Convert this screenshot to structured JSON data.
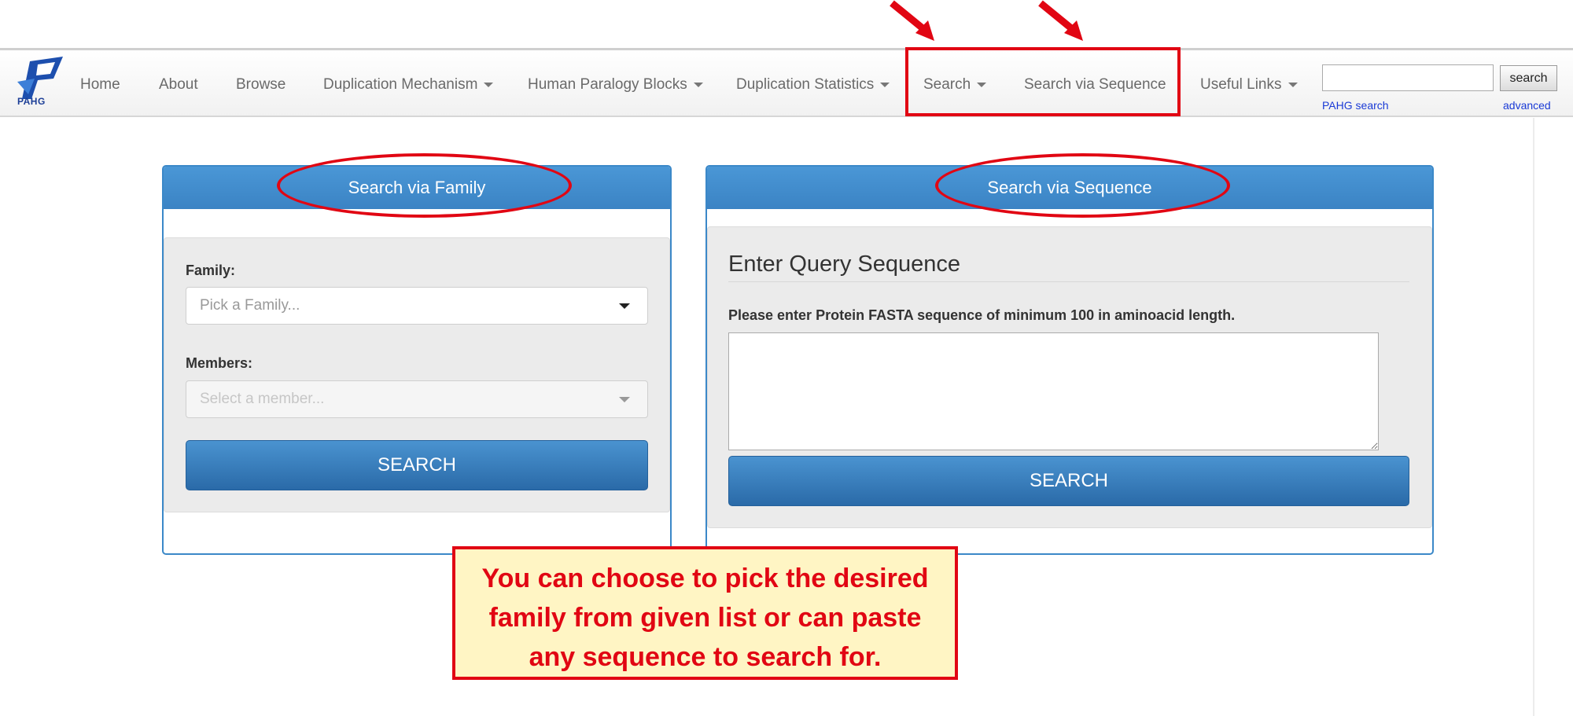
{
  "brand": {
    "logo_text": "PAHG"
  },
  "nav": {
    "items": [
      {
        "label": "Home",
        "dropdown": false
      },
      {
        "label": "About",
        "dropdown": false
      },
      {
        "label": "Browse",
        "dropdown": false
      },
      {
        "label": "Duplication Mechanism",
        "dropdown": true
      },
      {
        "label": "Human Paralogy Blocks",
        "dropdown": true
      },
      {
        "label": "Duplication Statistics",
        "dropdown": true
      },
      {
        "label": "Search",
        "dropdown": true
      },
      {
        "label": "Search via Sequence",
        "dropdown": false
      },
      {
        "label": "Useful Links",
        "dropdown": true
      }
    ],
    "search": {
      "input_value": "",
      "button_label": "search",
      "pahg_search_link": "PAHG search",
      "advanced_link": "advanced"
    }
  },
  "family_panel": {
    "heading": "Search via Family",
    "family_label": "Family:",
    "family_placeholder": "Pick a Family...",
    "members_label": "Members:",
    "members_placeholder": "Select a member...",
    "search_button": "SEARCH"
  },
  "sequence_panel": {
    "heading": "Search via Sequence",
    "title": "Enter Query Sequence",
    "instruction": "Please enter Protein FASTA sequence of minimum 100 in aminoacid length.",
    "textarea_value": "",
    "search_button": "SEARCH"
  },
  "callout": {
    "lines": [
      "You can choose to pick the desired",
      "family from given list or can paste",
      "any sequence to search for."
    ]
  },
  "colors": {
    "annotation_red": "#e10613",
    "panel_blue": "#3b88c8",
    "callout_bg": "#fff5c4"
  }
}
